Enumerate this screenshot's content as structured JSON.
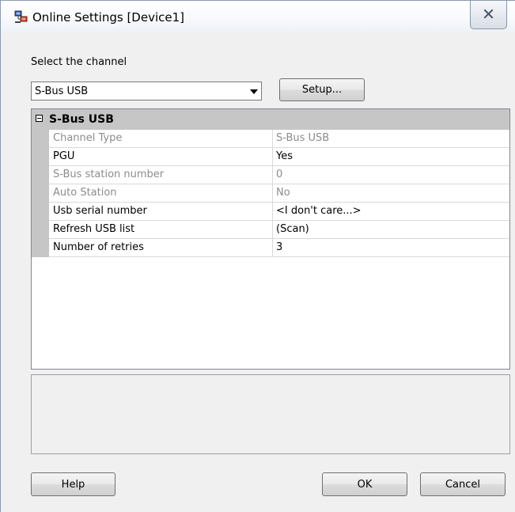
{
  "window": {
    "title": "Online Settings [Device1]"
  },
  "channel": {
    "label": "Select the channel",
    "selected": "S-Bus USB",
    "setup_button": "Setup..."
  },
  "grid": {
    "category": "S-Bus USB",
    "rows": [
      {
        "name": "Channel Type",
        "value": "S-Bus USB",
        "readonly": true
      },
      {
        "name": "PGU",
        "value": "Yes",
        "readonly": false
      },
      {
        "name": "S-Bus station number",
        "value": "0",
        "readonly": true
      },
      {
        "name": "Auto Station",
        "value": "No",
        "readonly": true
      },
      {
        "name": "Usb serial number",
        "value": "<I don't care...>",
        "readonly": false
      },
      {
        "name": "Refresh USB list",
        "value": "(Scan)",
        "readonly": false
      },
      {
        "name": "Number of retries",
        "value": "3",
        "readonly": false
      }
    ]
  },
  "buttons": {
    "help": "Help",
    "ok": "OK",
    "cancel": "Cancel"
  },
  "icons": {
    "app": "online-settings-icon",
    "close": "close-icon",
    "collapse": "collapse-minus-icon",
    "dropdown": "dropdown-arrow-icon"
  }
}
